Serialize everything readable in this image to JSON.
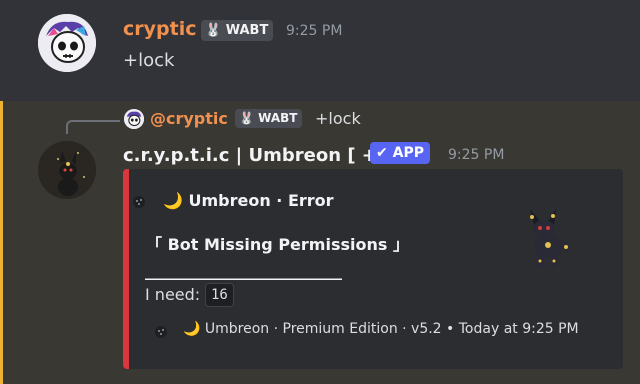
{
  "message1": {
    "author": "cryptic",
    "tag": "WABT",
    "tag_icon": "bunny-icon",
    "time": "9:25 PM",
    "content": "+lock"
  },
  "message2": {
    "reply": {
      "mention": "@cryptic",
      "tag": "WABT",
      "content": "+lock"
    },
    "author": "c.r.y.p.t.i.c | Umbreon [ + ]",
    "app_badge": "APP",
    "time": "9:25 PM",
    "embed": {
      "accent_color": "#da373c",
      "author_text": "🌙 Umbreon · Error",
      "title": "「 Bot Missing Permissions 」",
      "separator": "____________________________",
      "need_label": "I need:",
      "need_value": "16",
      "footer": "🌙 Umbreon · Premium Edition · v5.2 • Today at 9:25 PM"
    }
  },
  "colors": {
    "background": "#313338",
    "highlight": "#3a3833",
    "highlight_bar": "#f0b232",
    "username": "#f0914f",
    "app_badge": "#5865f2"
  }
}
